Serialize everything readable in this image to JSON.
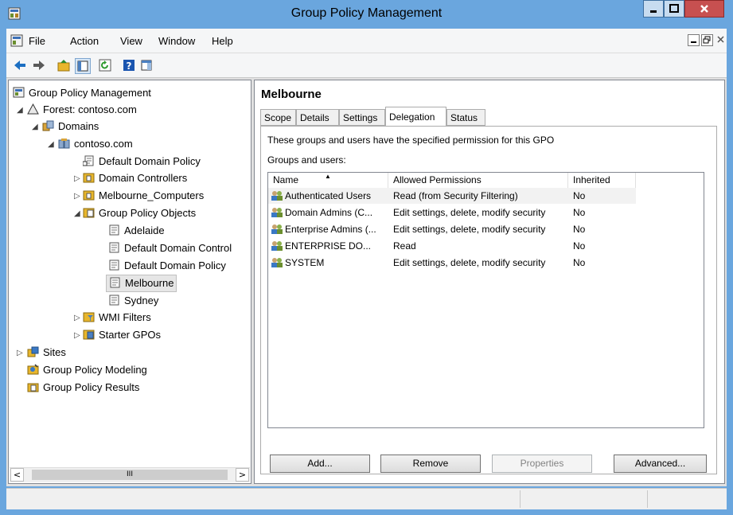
{
  "window": {
    "title": "Group Policy Management"
  },
  "menu": {
    "items": [
      "File",
      "Action",
      "View",
      "Window",
      "Help"
    ]
  },
  "tree": {
    "root": "Group Policy Management",
    "forest": "Forest: contoso.com",
    "domains": "Domains",
    "domain": "contoso.com",
    "default_domain_policy": "Default Domain Policy",
    "domain_controllers": "Domain Controllers",
    "melbourne_computers": "Melbourne_Computers",
    "gpo_container": "Group Policy Objects",
    "gpos": [
      "Adelaide",
      "Default Domain Control",
      "Default Domain Policy",
      "Melbourne",
      "Sydney"
    ],
    "wmi_filters": "WMI Filters",
    "starter_gpos": "Starter GPOs",
    "sites": "Sites",
    "modeling": "Group Policy Modeling",
    "results": "Group Policy Results",
    "scroll_thumb": "III"
  },
  "detail": {
    "title": "Melbourne",
    "tabs": [
      "Scope",
      "Details",
      "Settings",
      "Delegation",
      "Status"
    ],
    "active_tab": "Delegation",
    "info_text": "These groups and users have the specified permission for this GPO",
    "groups_label": "Groups and users:",
    "columns": [
      "Name",
      "Allowed Permissions",
      "Inherited"
    ],
    "rows": [
      {
        "name": "Authenticated Users",
        "permission": "Read (from Security Filtering)",
        "inherited": "No"
      },
      {
        "name": "Domain Admins (C...",
        "permission": "Edit settings, delete, modify security",
        "inherited": "No"
      },
      {
        "name": "Enterprise Admins (...",
        "permission": "Edit settings, delete, modify security",
        "inherited": "No"
      },
      {
        "name": "ENTERPRISE DO...",
        "permission": "Read",
        "inherited": "No"
      },
      {
        "name": "SYSTEM",
        "permission": "Edit settings, delete, modify security",
        "inherited": "No"
      }
    ],
    "buttons": {
      "add": "Add...",
      "remove": "Remove",
      "properties": "Properties",
      "advanced": "Advanced..."
    }
  },
  "colors": {
    "titlebar": "#6aa6de",
    "close": "#c75050",
    "panel": "#e1e1e1"
  }
}
